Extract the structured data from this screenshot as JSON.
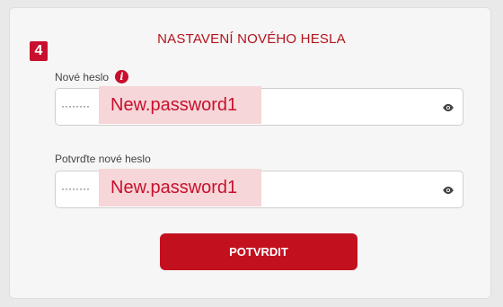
{
  "step": {
    "number": "4"
  },
  "form": {
    "title": "NASTAVENÍ NOVÉHO HESLA",
    "new_password": {
      "label": "Nové heslo",
      "masked_value": "········",
      "highlight_text": "New.password1"
    },
    "confirm_password": {
      "label": "Potvrďte nové heslo",
      "masked_value": "········",
      "highlight_text": "New.password1"
    },
    "submit_label": "POTVRDIT"
  },
  "colors": {
    "accent": "#c8102e",
    "highlight_bg": "#f6d6d8"
  },
  "icons": {
    "info": "info-icon",
    "visibility": "eye-icon"
  }
}
